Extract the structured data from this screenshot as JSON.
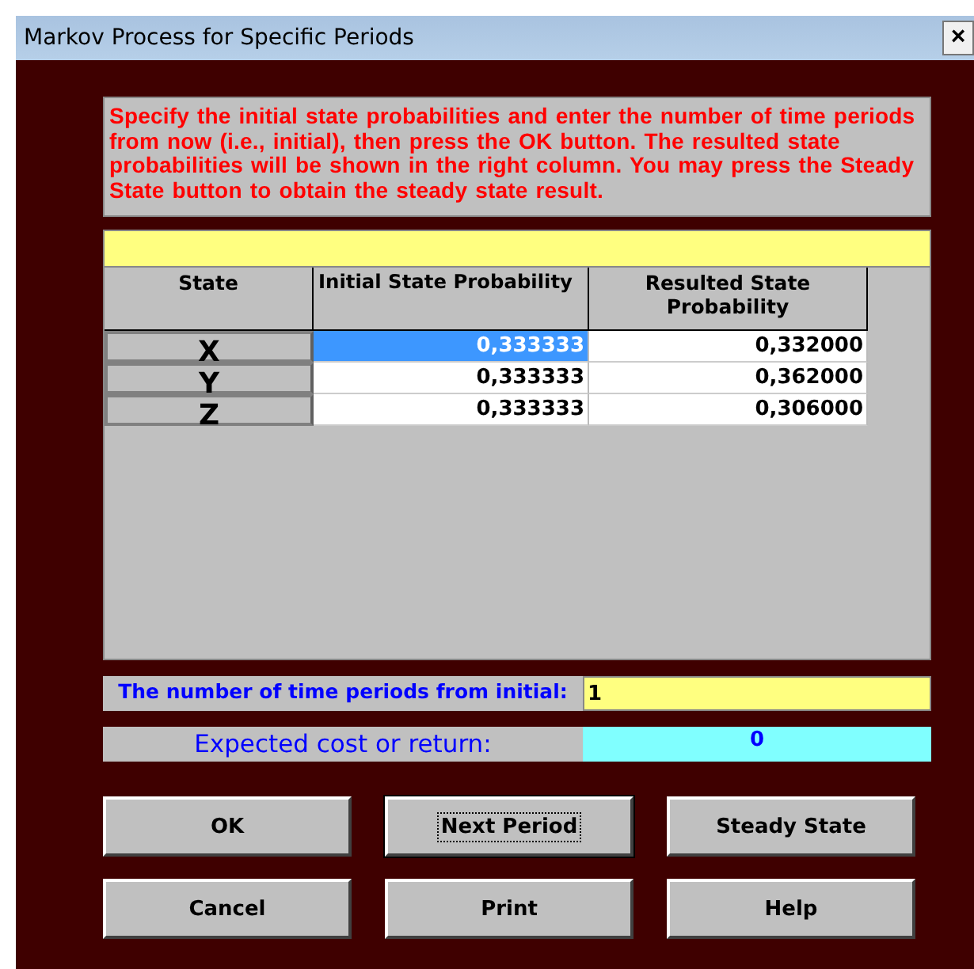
{
  "window": {
    "title": "Markov Process for Specific Periods",
    "close": "×"
  },
  "instructions": "Specify the initial state probabilities and enter the number of time periods from now (i.e., initial), then press the OK button.  The resulted state probabilities will be shown in the right column.  You may press the Steady State button to obtain the steady state result.",
  "table": {
    "columns": [
      "State",
      "Initial State Probability",
      "Resulted State Probability"
    ],
    "rows": [
      {
        "state": "X",
        "initial": "0,333333",
        "resulted": "0,332000",
        "selected": true
      },
      {
        "state": "Y",
        "initial": "0,333333",
        "resulted": "0,362000",
        "selected": false
      },
      {
        "state": "Z",
        "initial": "0,333333",
        "resulted": "0,306000",
        "selected": false
      }
    ]
  },
  "periods": {
    "label": "The number of time periods from initial:",
    "value": "1"
  },
  "expected": {
    "label": "Expected cost or return:",
    "value": "0"
  },
  "buttons": [
    {
      "label": "OK",
      "focused": false
    },
    {
      "label": "Next Period",
      "focused": true
    },
    {
      "label": "Steady State",
      "focused": false
    },
    {
      "label": "Cancel",
      "focused": false
    },
    {
      "label": "Print",
      "focused": false
    },
    {
      "label": "Help",
      "focused": false
    }
  ]
}
